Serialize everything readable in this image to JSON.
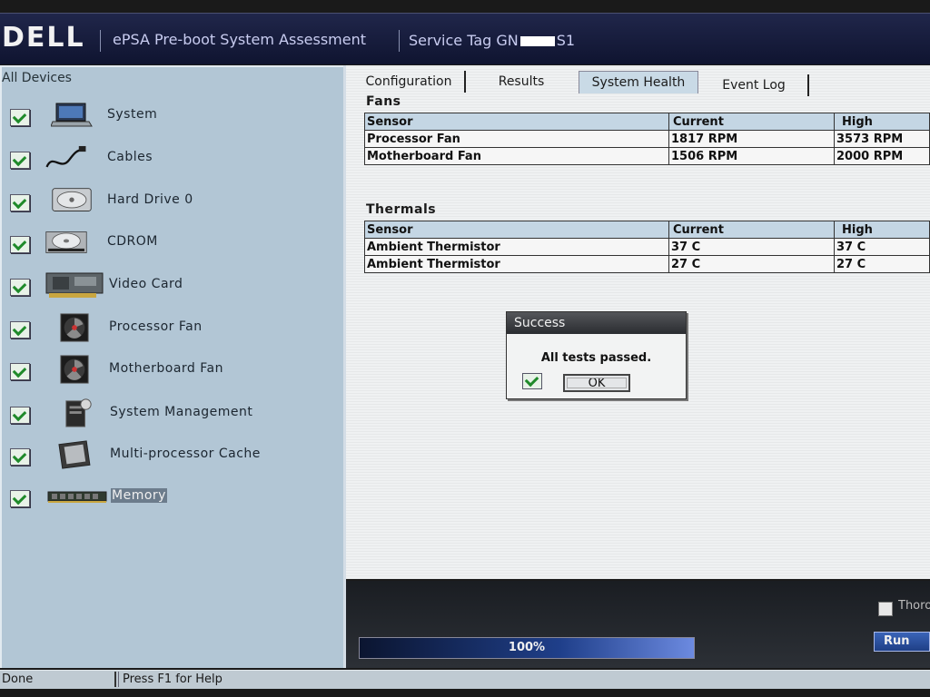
{
  "header": {
    "logo": "DELL",
    "app_title": "ePSA Pre-boot System Assessment",
    "service_tag_prefix": "Service Tag GN",
    "service_tag_suffix": "S1"
  },
  "device_panel": {
    "header": "All Devices",
    "items": [
      {
        "label": "System",
        "icon": "laptop-icon"
      },
      {
        "label": "Cables",
        "icon": "cable-icon"
      },
      {
        "label": "Hard Drive 0",
        "icon": "hard-drive-icon"
      },
      {
        "label": "CDROM",
        "icon": "cdrom-icon"
      },
      {
        "label": "Video Card",
        "icon": "video-card-icon"
      },
      {
        "label": "Processor Fan",
        "icon": "fan-icon"
      },
      {
        "label": "Motherboard Fan",
        "icon": "fan-icon"
      },
      {
        "label": "System Management",
        "icon": "system-management-icon"
      },
      {
        "label": "Multi-processor Cache",
        "icon": "cpu-chip-icon"
      },
      {
        "label": "Memory",
        "icon": "memory-module-icon"
      }
    ]
  },
  "tabs": [
    {
      "label": "Configuration"
    },
    {
      "label": "Results"
    },
    {
      "label": "System Health",
      "active": true
    },
    {
      "label": "Event Log"
    }
  ],
  "fans": {
    "title": "Fans",
    "headers": [
      "Sensor",
      "Current",
      "High"
    ],
    "rows": [
      [
        "Processor Fan",
        "1817 RPM",
        "3573 RPM"
      ],
      [
        "Motherboard Fan",
        "1506 RPM",
        "2000 RPM"
      ]
    ]
  },
  "thermals": {
    "title": "Thermals",
    "headers": [
      "Sensor",
      "Current",
      "High"
    ],
    "rows": [
      [
        "Ambient Thermistor",
        "37 C",
        "37 C"
      ],
      [
        "Ambient Thermistor",
        "27 C",
        "27 C"
      ]
    ]
  },
  "dialog": {
    "title": "Success",
    "message": "All tests passed.",
    "ok_label": "OK"
  },
  "progress": {
    "text": "100%",
    "value": 100
  },
  "controls": {
    "thorough_label": "Thoro",
    "run_label": "Run"
  },
  "status_bar": {
    "left": "Done",
    "right": "Press F1 for Help"
  },
  "colors": {
    "panel": "#b2c6d5",
    "check": "#1f8a2a",
    "title_bar": "#20264a"
  }
}
